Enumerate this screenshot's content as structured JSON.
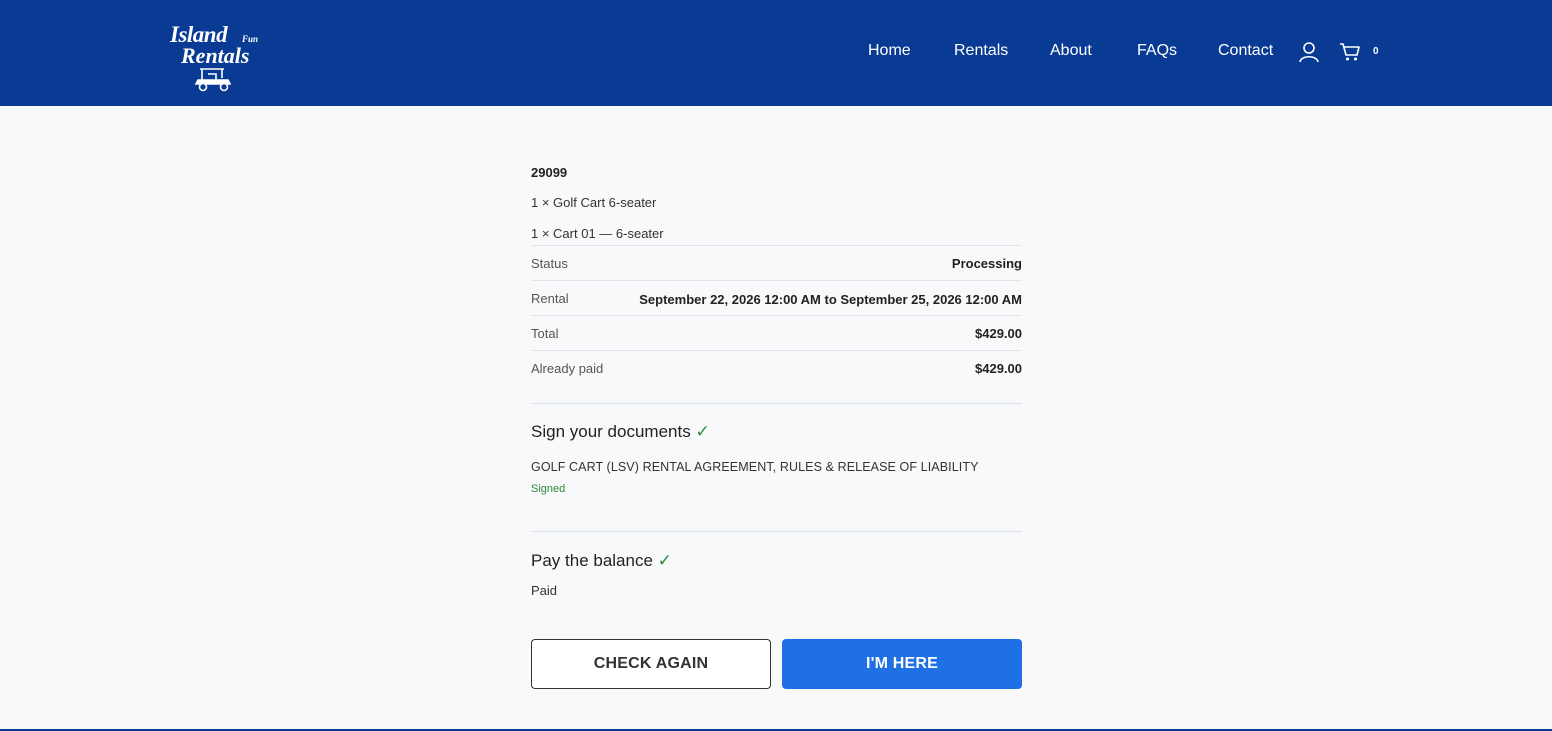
{
  "brand": {
    "logo_line1": "Island",
    "logo_small": "Fun",
    "logo_line2": "Rentals"
  },
  "nav": {
    "items": [
      "Home",
      "Rentals",
      "About",
      "FAQs",
      "Contact"
    ],
    "cart_count": "0"
  },
  "order": {
    "number": "29099",
    "items": [
      "1 × Golf Cart 6-seater",
      "1 × Cart 01 — 6-seater"
    ],
    "details": [
      {
        "label": "Status",
        "value": "Processing"
      },
      {
        "label": "Rental",
        "value": "September 22, 2026 12:00 AM to September 25, 2026 12:00 AM"
      },
      {
        "label": "Total",
        "value": "$429.00"
      },
      {
        "label": "Already paid",
        "value": "$429.00"
      }
    ]
  },
  "documents": {
    "title": "Sign your documents",
    "check": "✓",
    "doc_name": "GOLF CART (LSV) RENTAL AGREEMENT, RULES & RELEASE OF LIABILITY",
    "doc_status": "Signed"
  },
  "balance": {
    "title": "Pay the balance",
    "check": "✓",
    "status": "Paid"
  },
  "actions": {
    "check_again": "CHECK AGAIN",
    "im_here": "I'M HERE"
  },
  "colors": {
    "header_bg": "#0a3b94",
    "primary": "#1f6fe5",
    "success": "#2a8a3a"
  }
}
